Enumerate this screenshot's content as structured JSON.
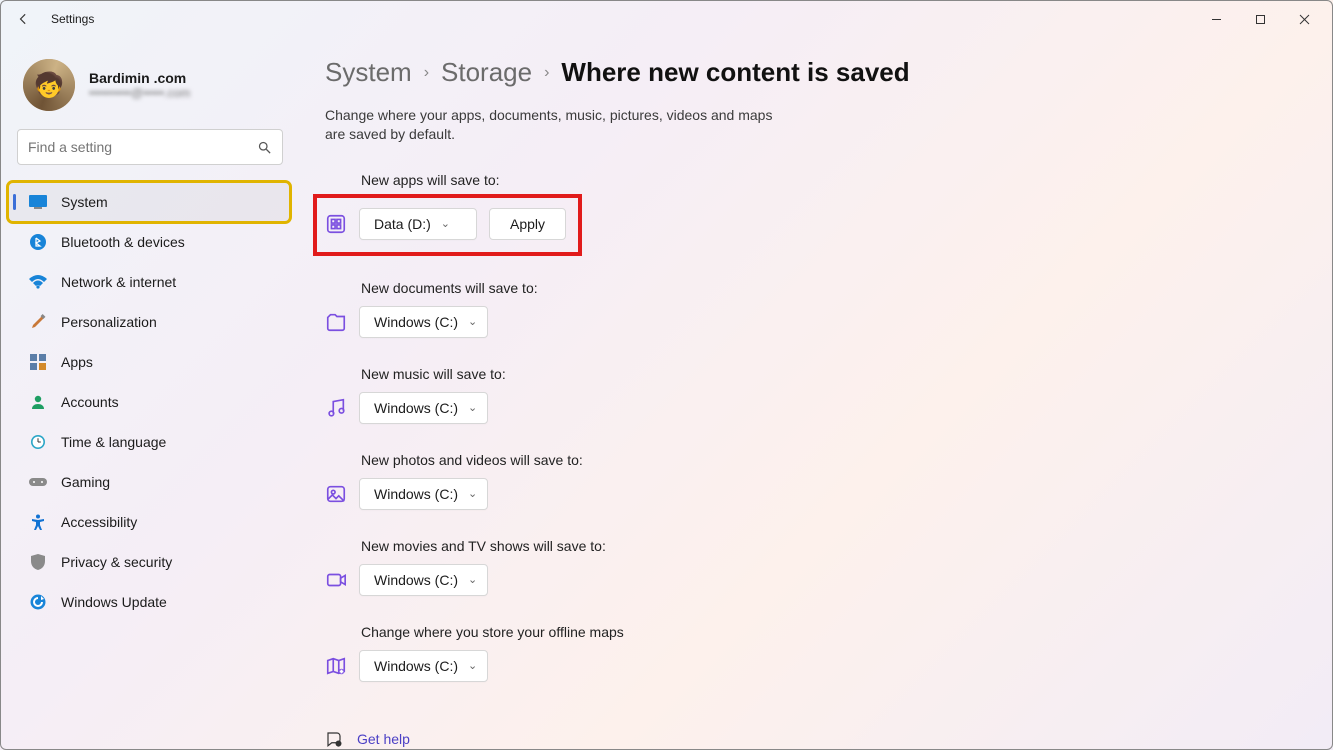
{
  "titlebar": {
    "back_icon_alt": "Back",
    "app_title": "Settings"
  },
  "window_controls": {
    "minimize": "—",
    "maximize": "□",
    "close": "✕"
  },
  "profile": {
    "name": "Bardimin .com",
    "email_masked": "••••••••••@•••••.com"
  },
  "search": {
    "placeholder": "Find a setting"
  },
  "sidebar": {
    "selected_index": 0,
    "items": [
      {
        "label": "System",
        "icon": "system-icon"
      },
      {
        "label": "Bluetooth & devices",
        "icon": "bluetooth-icon"
      },
      {
        "label": "Network & internet",
        "icon": "wifi-icon"
      },
      {
        "label": "Personalization",
        "icon": "brush-icon"
      },
      {
        "label": "Apps",
        "icon": "apps-icon"
      },
      {
        "label": "Accounts",
        "icon": "person-icon"
      },
      {
        "label": "Time & language",
        "icon": "clock-icon"
      },
      {
        "label": "Gaming",
        "icon": "gamepad-icon"
      },
      {
        "label": "Accessibility",
        "icon": "accessibility-icon"
      },
      {
        "label": "Privacy & security",
        "icon": "shield-icon"
      },
      {
        "label": "Windows Update",
        "icon": "update-icon"
      }
    ]
  },
  "breadcrumb": {
    "items": [
      "System",
      "Storage",
      "Where new content is saved"
    ]
  },
  "description": "Change where your apps, documents, music, pictures, videos and maps are saved by default.",
  "categories": [
    {
      "label": "New apps will save to:",
      "icon": "apps-category-icon",
      "drive": "Data (D:)",
      "show_apply": true,
      "highlight": true
    },
    {
      "label": "New documents will save to:",
      "icon": "documents-category-icon",
      "drive": "Windows (C:)",
      "show_apply": false,
      "highlight": false
    },
    {
      "label": "New music will save to:",
      "icon": "music-category-icon",
      "drive": "Windows (C:)",
      "show_apply": false,
      "highlight": false
    },
    {
      "label": "New photos and videos will save to:",
      "icon": "photos-category-icon",
      "drive": "Windows (C:)",
      "show_apply": false,
      "highlight": false
    },
    {
      "label": "New movies and TV shows will save to:",
      "icon": "movies-category-icon",
      "drive": "Windows (C:)",
      "show_apply": false,
      "highlight": false
    },
    {
      "label": "Change where you store your offline maps",
      "icon": "maps-category-icon",
      "drive": "Windows (C:)",
      "show_apply": false,
      "highlight": false
    }
  ],
  "apply_label": "Apply",
  "gethelp": {
    "label": "Get help"
  }
}
